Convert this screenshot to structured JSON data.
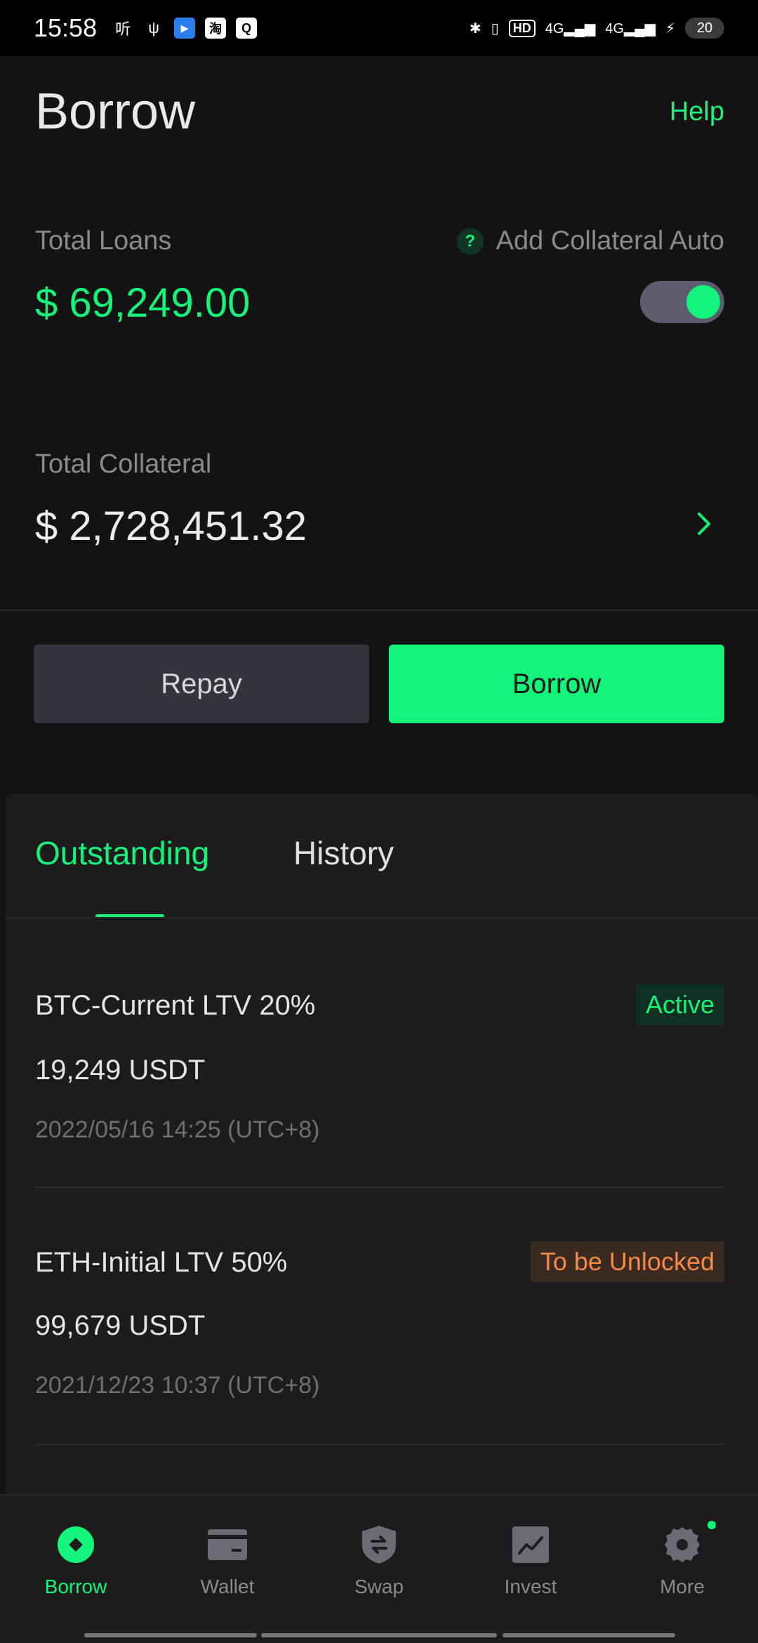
{
  "status_bar": {
    "time": "15:58",
    "left_icons": [
      "听",
      "ψ",
      "▸",
      "淘",
      "Q"
    ],
    "network_4g_1": "4G",
    "network_4g_2": "4G",
    "hd_label": "HD",
    "battery": "20"
  },
  "header": {
    "title": "Borrow",
    "help": "Help"
  },
  "loans": {
    "total_loans_label": "Total Loans",
    "total_loans_value": "$ 69,249.00",
    "auto_label": "Add Collateral Auto",
    "auto_enabled": true,
    "total_collateral_label": "Total Collateral",
    "total_collateral_value": "$ 2,728,451.32"
  },
  "actions": {
    "repay_label": "Repay",
    "borrow_label": "Borrow"
  },
  "tabs": [
    {
      "label": "Outstanding",
      "active": true
    },
    {
      "label": "History",
      "active": false
    }
  ],
  "loan_items": [
    {
      "title": "BTC-Current LTV 20%",
      "amount": "19,249 USDT",
      "time": "2022/05/16 14:25 (UTC+8)",
      "status": "Active"
    },
    {
      "title": "ETH-Initial LTV 50%",
      "amount": "99,679 USDT",
      "time": "2021/12/23 10:37 (UTC+8)",
      "status": "To be Unlocked"
    }
  ],
  "bottom_nav": [
    {
      "label": "Borrow",
      "icon": "borrow-icon",
      "active": true
    },
    {
      "label": "Wallet",
      "icon": "wallet-icon",
      "active": false
    },
    {
      "label": "Swap",
      "icon": "swap-icon",
      "active": false
    },
    {
      "label": "Invest",
      "icon": "invest-icon",
      "active": false
    },
    {
      "label": "More",
      "icon": "gear-icon",
      "active": false
    }
  ],
  "colors": {
    "accent": "#12f47a",
    "background": "#131313",
    "panel": "#1c1c1c",
    "warning": "#f5894a"
  }
}
